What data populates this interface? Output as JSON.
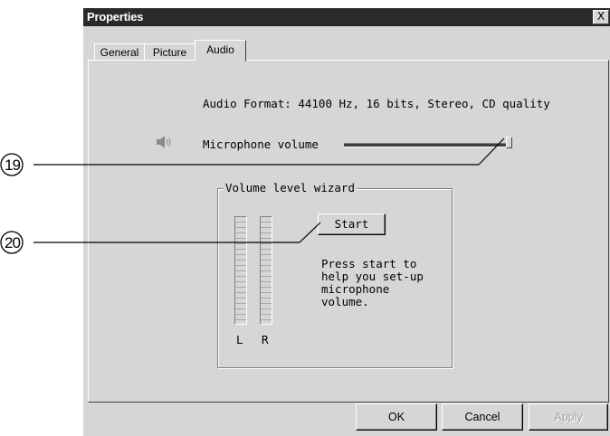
{
  "window": {
    "title": "Properties",
    "close_label": "X"
  },
  "tabs": [
    {
      "label": "General"
    },
    {
      "label": "Picture"
    },
    {
      "label": "Audio",
      "active": true
    }
  ],
  "audio": {
    "format_text": "Audio Format: 44100 Hz, 16 bits, Stereo, CD quality",
    "microphone_label": "Microphone volume",
    "microphone_volume_fraction": 1.0
  },
  "wizard": {
    "title": "Volume level wizard",
    "start_label": "Start",
    "help_text": "Press start to\nhelp you set-up\nmicrophone\nvolume.",
    "left_label": "L",
    "right_label": "R"
  },
  "buttons": {
    "ok_label": "OK",
    "cancel_label": "Cancel",
    "apply_label": "Apply"
  },
  "callouts": [
    {
      "number": "19",
      "target": "microphone volume slider"
    },
    {
      "number": "20",
      "target": "start button"
    }
  ],
  "icons": {
    "speaker": "speaker-icon"
  },
  "colors": {
    "title_bar": "#2a2a2a",
    "dialog_face": "#d6d6d6"
  }
}
